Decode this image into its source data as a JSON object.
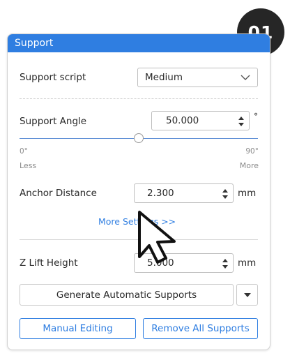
{
  "badge": {
    "step": "01"
  },
  "panel": {
    "title": "Support",
    "support_script": {
      "label": "Support script",
      "value": "Medium"
    },
    "support_angle": {
      "label": "Support Angle",
      "value": "50.000",
      "unit": "°",
      "slider_fraction": 0.5,
      "min_label": "0°",
      "max_label": "90°",
      "min_caption": "Less",
      "max_caption": "More"
    },
    "anchor_distance": {
      "label": "Anchor Distance",
      "value": "2.300",
      "unit": "mm"
    },
    "more_settings": "More Settings >>",
    "z_lift_height": {
      "label": "Z Lift Height",
      "value": "5.000",
      "unit": "mm"
    },
    "generate_button": "Generate Automatic Supports",
    "manual_button": "Manual Editing",
    "remove_button": "Remove All Supports"
  },
  "colors": {
    "accent": "#2f7ee1",
    "badge": "#262626"
  }
}
